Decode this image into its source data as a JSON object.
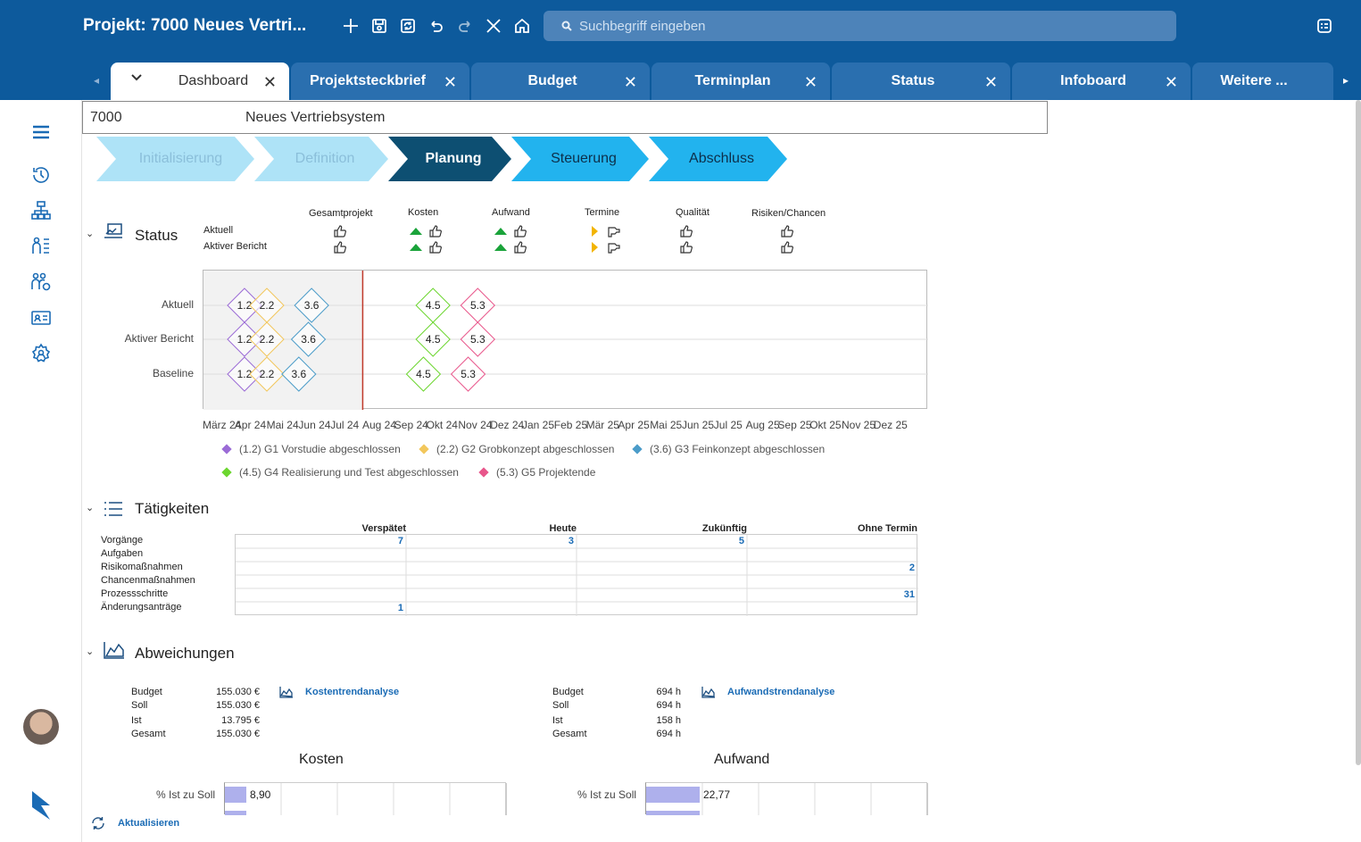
{
  "app": {
    "title": "Projekt: 7000 Neues Vertri...",
    "search_placeholder": "Suchbegriff eingeben"
  },
  "tabs": [
    {
      "label": "Dashboard",
      "active": true
    },
    {
      "label": "Projektsteckbrief"
    },
    {
      "label": "Budget"
    },
    {
      "label": "Terminplan"
    },
    {
      "label": "Status"
    },
    {
      "label": "Infoboard"
    },
    {
      "label": "Weitere ..."
    }
  ],
  "project": {
    "number": "7000",
    "name": "Neues Vertriebsystem"
  },
  "phases": [
    {
      "label": "Initialisierung",
      "state": "done"
    },
    {
      "label": "Definition",
      "state": "done"
    },
    {
      "label": "Planung",
      "state": "current"
    },
    {
      "label": "Steuerung",
      "state": "future"
    },
    {
      "label": "Abschluss",
      "state": "future"
    }
  ],
  "status": {
    "title": "Status",
    "rows": [
      "Aktuell",
      "Aktiver Bericht"
    ],
    "columns": [
      "Gesamtprojekt",
      "Kosten",
      "Aufwand",
      "Termine",
      "Qualität",
      "Risiken/Chancen"
    ]
  },
  "chart_data": {
    "type": "scatter",
    "categories": [
      "Aktuell",
      "Aktiver Bericht",
      "Baseline"
    ],
    "x_ticks": [
      "März 24",
      "Apr 24",
      "Mai 24",
      "Jun 24",
      "Jul 24",
      "Aug 24",
      "Sep 24",
      "Okt 24",
      "Nov 24",
      "Dez 24",
      "Jan 25",
      "Feb 25",
      "Mär 25",
      "Apr 25",
      "Mai 25",
      "Jun 25",
      "Jul 25",
      "Aug 25",
      "Sep 25",
      "Okt 25",
      "Nov 25",
      "Dez 25"
    ],
    "series": [
      {
        "name": "(1.2) G1 Vorstudie abgeschlossen",
        "label": "1.2",
        "color": "#9b6bd6",
        "values": [
          1.2,
          1.2,
          1.2
        ]
      },
      {
        "name": "(2.2) G2 Grobkonzept abgeschlossen",
        "label": "2.2",
        "color": "#f2c75c",
        "values": [
          1.9,
          1.9,
          1.9
        ]
      },
      {
        "name": "(3.6) G3 Feinkonzept abgeschlossen",
        "label": "3.6",
        "color": "#4b9cc9",
        "values": [
          3.3,
          3.2,
          2.9
        ]
      },
      {
        "name": "(4.5) G4 Realisierung und Test abgeschlossen",
        "label": "4.5",
        "color": "#6cd62f",
        "values": [
          7.1,
          7.1,
          6.8
        ]
      },
      {
        "name": "(5.3) G5 Projektende",
        "label": "5.3",
        "color": "#e8568b",
        "values": [
          8.5,
          8.5,
          8.2
        ]
      }
    ],
    "today": 4.9,
    "shaded_until": 4.9
  },
  "activities": {
    "title": "Tätigkeiten",
    "columns": [
      "Verspätet",
      "Heute",
      "Zukünftig",
      "Ohne Termin"
    ],
    "rows": [
      {
        "label": "Vorgänge",
        "values": [
          "7",
          "3",
          "5",
          ""
        ]
      },
      {
        "label": "Aufgaben",
        "values": [
          "",
          "",
          "",
          ""
        ]
      },
      {
        "label": "Risikomaßnahmen",
        "values": [
          "",
          "",
          "",
          "2"
        ]
      },
      {
        "label": "Chancenmaßnahmen",
        "values": [
          "",
          "",
          "",
          ""
        ]
      },
      {
        "label": "Prozessschritte",
        "values": [
          "",
          "",
          "",
          "31"
        ]
      },
      {
        "label": "Änderungsanträge",
        "values": [
          "1",
          "",
          "",
          ""
        ]
      }
    ]
  },
  "deviations": {
    "title": "Abweichungen",
    "costs": {
      "link": "Kostentrendanalyse",
      "rows": [
        {
          "label": "Budget",
          "value": "155.030 €"
        },
        {
          "label": "Soll",
          "value": "155.030 €"
        },
        {
          "label": "Ist",
          "value": "13.795 €"
        },
        {
          "label": "Gesamt",
          "value": "155.030 €"
        }
      ],
      "chart_title": "Kosten",
      "bar_label": "% Ist zu Soll",
      "bar_value": "8,90"
    },
    "effort": {
      "link": "Aufwandstrendanalyse",
      "rows": [
        {
          "label": "Budget",
          "value": "694 h"
        },
        {
          "label": "Soll",
          "value": "694 h"
        },
        {
          "label": "Ist",
          "value": "158 h"
        },
        {
          "label": "Gesamt",
          "value": "694 h"
        }
      ],
      "chart_title": "Aufwand",
      "bar_label": "% Ist zu Soll",
      "bar_value": "22,77"
    }
  },
  "footer": {
    "refresh": "Aktualisieren"
  }
}
